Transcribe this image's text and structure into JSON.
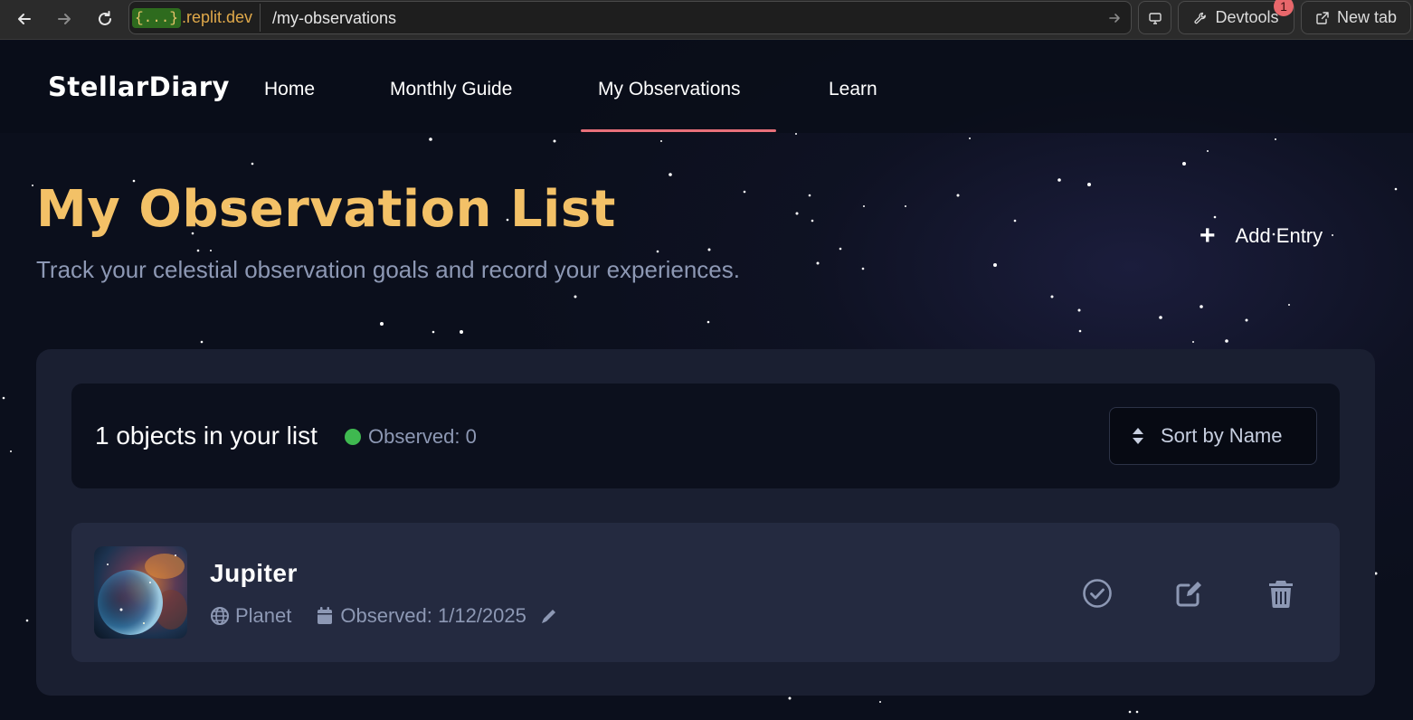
{
  "browser": {
    "url_badge": "{...}",
    "url_domain": ".replit.dev",
    "url_path": "/my-observations",
    "devtools_label": "Devtools",
    "devtools_notifications": "1",
    "new_tab_label": "New tab"
  },
  "nav": {
    "brand": "StellarDiary",
    "items": [
      {
        "label": "Home",
        "active": false
      },
      {
        "label": "Monthly Guide",
        "active": false
      },
      {
        "label": "My Observations",
        "active": true
      },
      {
        "label": "Learn",
        "active": false
      }
    ],
    "active_color": "#e8707a"
  },
  "page": {
    "title": "My Observation List",
    "subtitle": "Track your celestial observation goals and record your experiences.",
    "add_entry_icon": "+",
    "add_entry_label": "Add Entry",
    "title_color": "#f3c167"
  },
  "summary": {
    "count_text": "1 objects in your list",
    "observed_text": "Observed: 0",
    "observed_dot_color": "#3fb950",
    "sort_label": "Sort by Name"
  },
  "observations": [
    {
      "name": "Jupiter",
      "type": "Planet",
      "observed_text": "Observed: 1/12/2025",
      "thumbnail": "nebula-image",
      "actions": [
        "check-circle-icon",
        "edit-icon",
        "trash-icon"
      ]
    }
  ]
}
